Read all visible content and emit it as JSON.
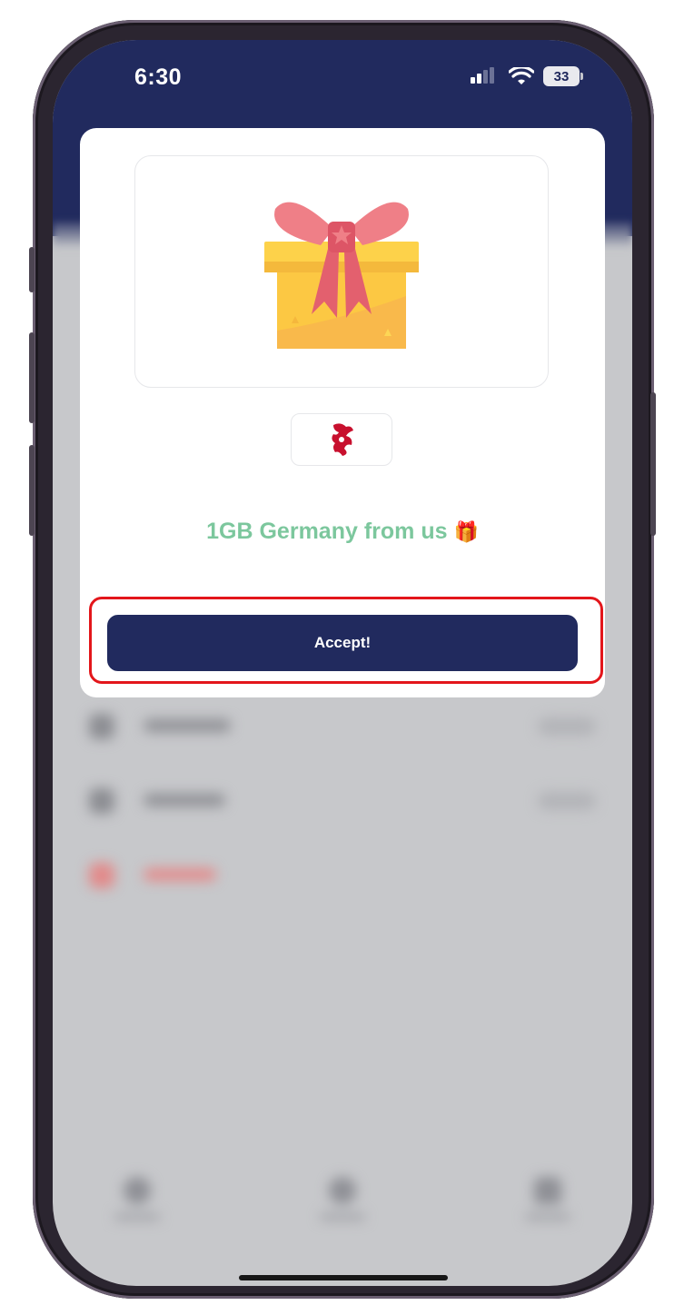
{
  "status_bar": {
    "time": "6:30",
    "battery": "33"
  },
  "modal": {
    "gift_icon": "gift-box-icon",
    "flag_icon": "georgia-dragon-emblem-icon",
    "title": "1GB Germany from us",
    "title_emoji": "🎁",
    "accept_label": "Accept!"
  },
  "colors": {
    "header": "#212a5e",
    "button": "#212a5e",
    "title_green": "#7cc79d",
    "highlight_red": "#e3161b"
  }
}
